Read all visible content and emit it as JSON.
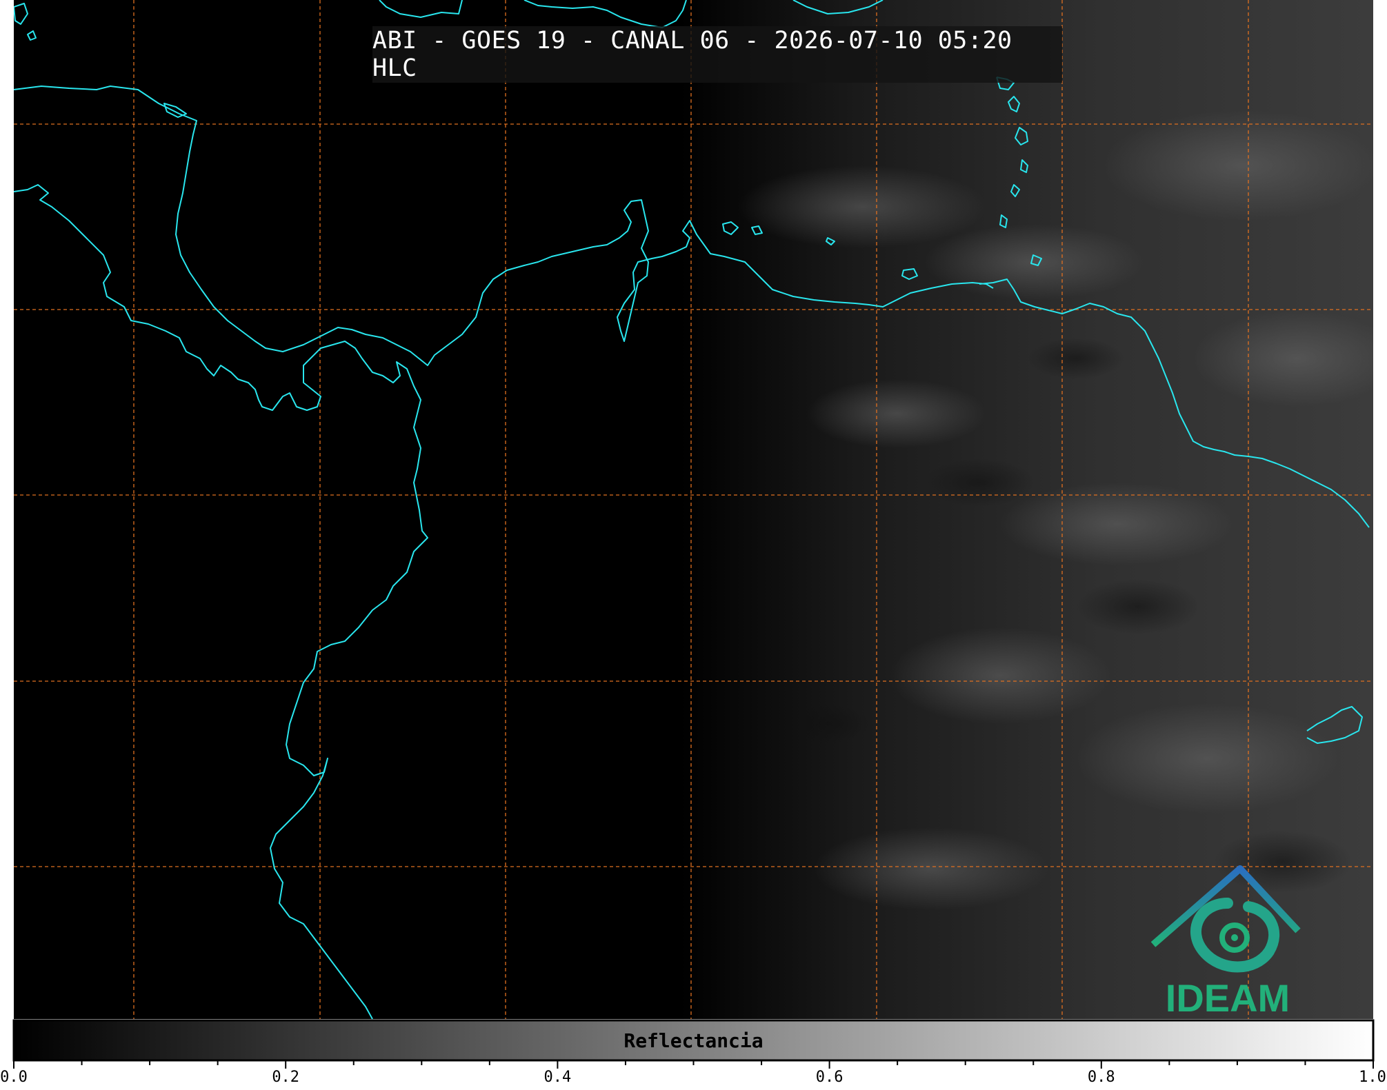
{
  "title": "ABI - GOES 19 - CANAL 06 - 2026-07-10 05:20 HLC",
  "colorbar": {
    "label": "Reflectancia",
    "ticks": [
      "0.0",
      "0.2",
      "0.4",
      "0.6",
      "0.8",
      "1.0"
    ],
    "range": [
      0.0,
      1.0
    ],
    "colormap": [
      "#000000",
      "#ffffff"
    ]
  },
  "logo": {
    "text": "IDEAM"
  },
  "colors": {
    "coastline": "#29e6ee",
    "gridlines": "#e07020",
    "background": "#000000"
  }
}
